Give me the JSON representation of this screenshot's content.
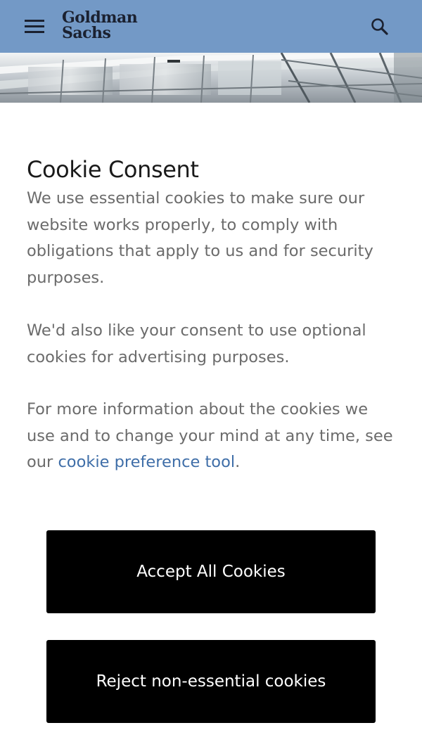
{
  "header": {
    "logo_line1": "Goldman",
    "logo_line2": "Sachs",
    "menu_icon": "hamburger-menu-icon",
    "search_icon": "search-icon",
    "background_color": "#7399c6"
  },
  "consent": {
    "title": "Cookie Consent",
    "paragraph1": "We use essential cookies to make sure our website works properly, to comply with obligations that apply to us and for security purposes.",
    "paragraph2": "We'd also like your consent to use optional cookies for advertising purposes.",
    "paragraph3_prefix": "For more information about the cookies we use and to change your mind at any time, see our ",
    "paragraph3_link": "cookie preference tool",
    "paragraph3_suffix": ".",
    "link_color": "#3f6ea8"
  },
  "buttons": {
    "accept_label": "Accept All Cookies",
    "reject_label": "Reject non-essential cookies"
  }
}
